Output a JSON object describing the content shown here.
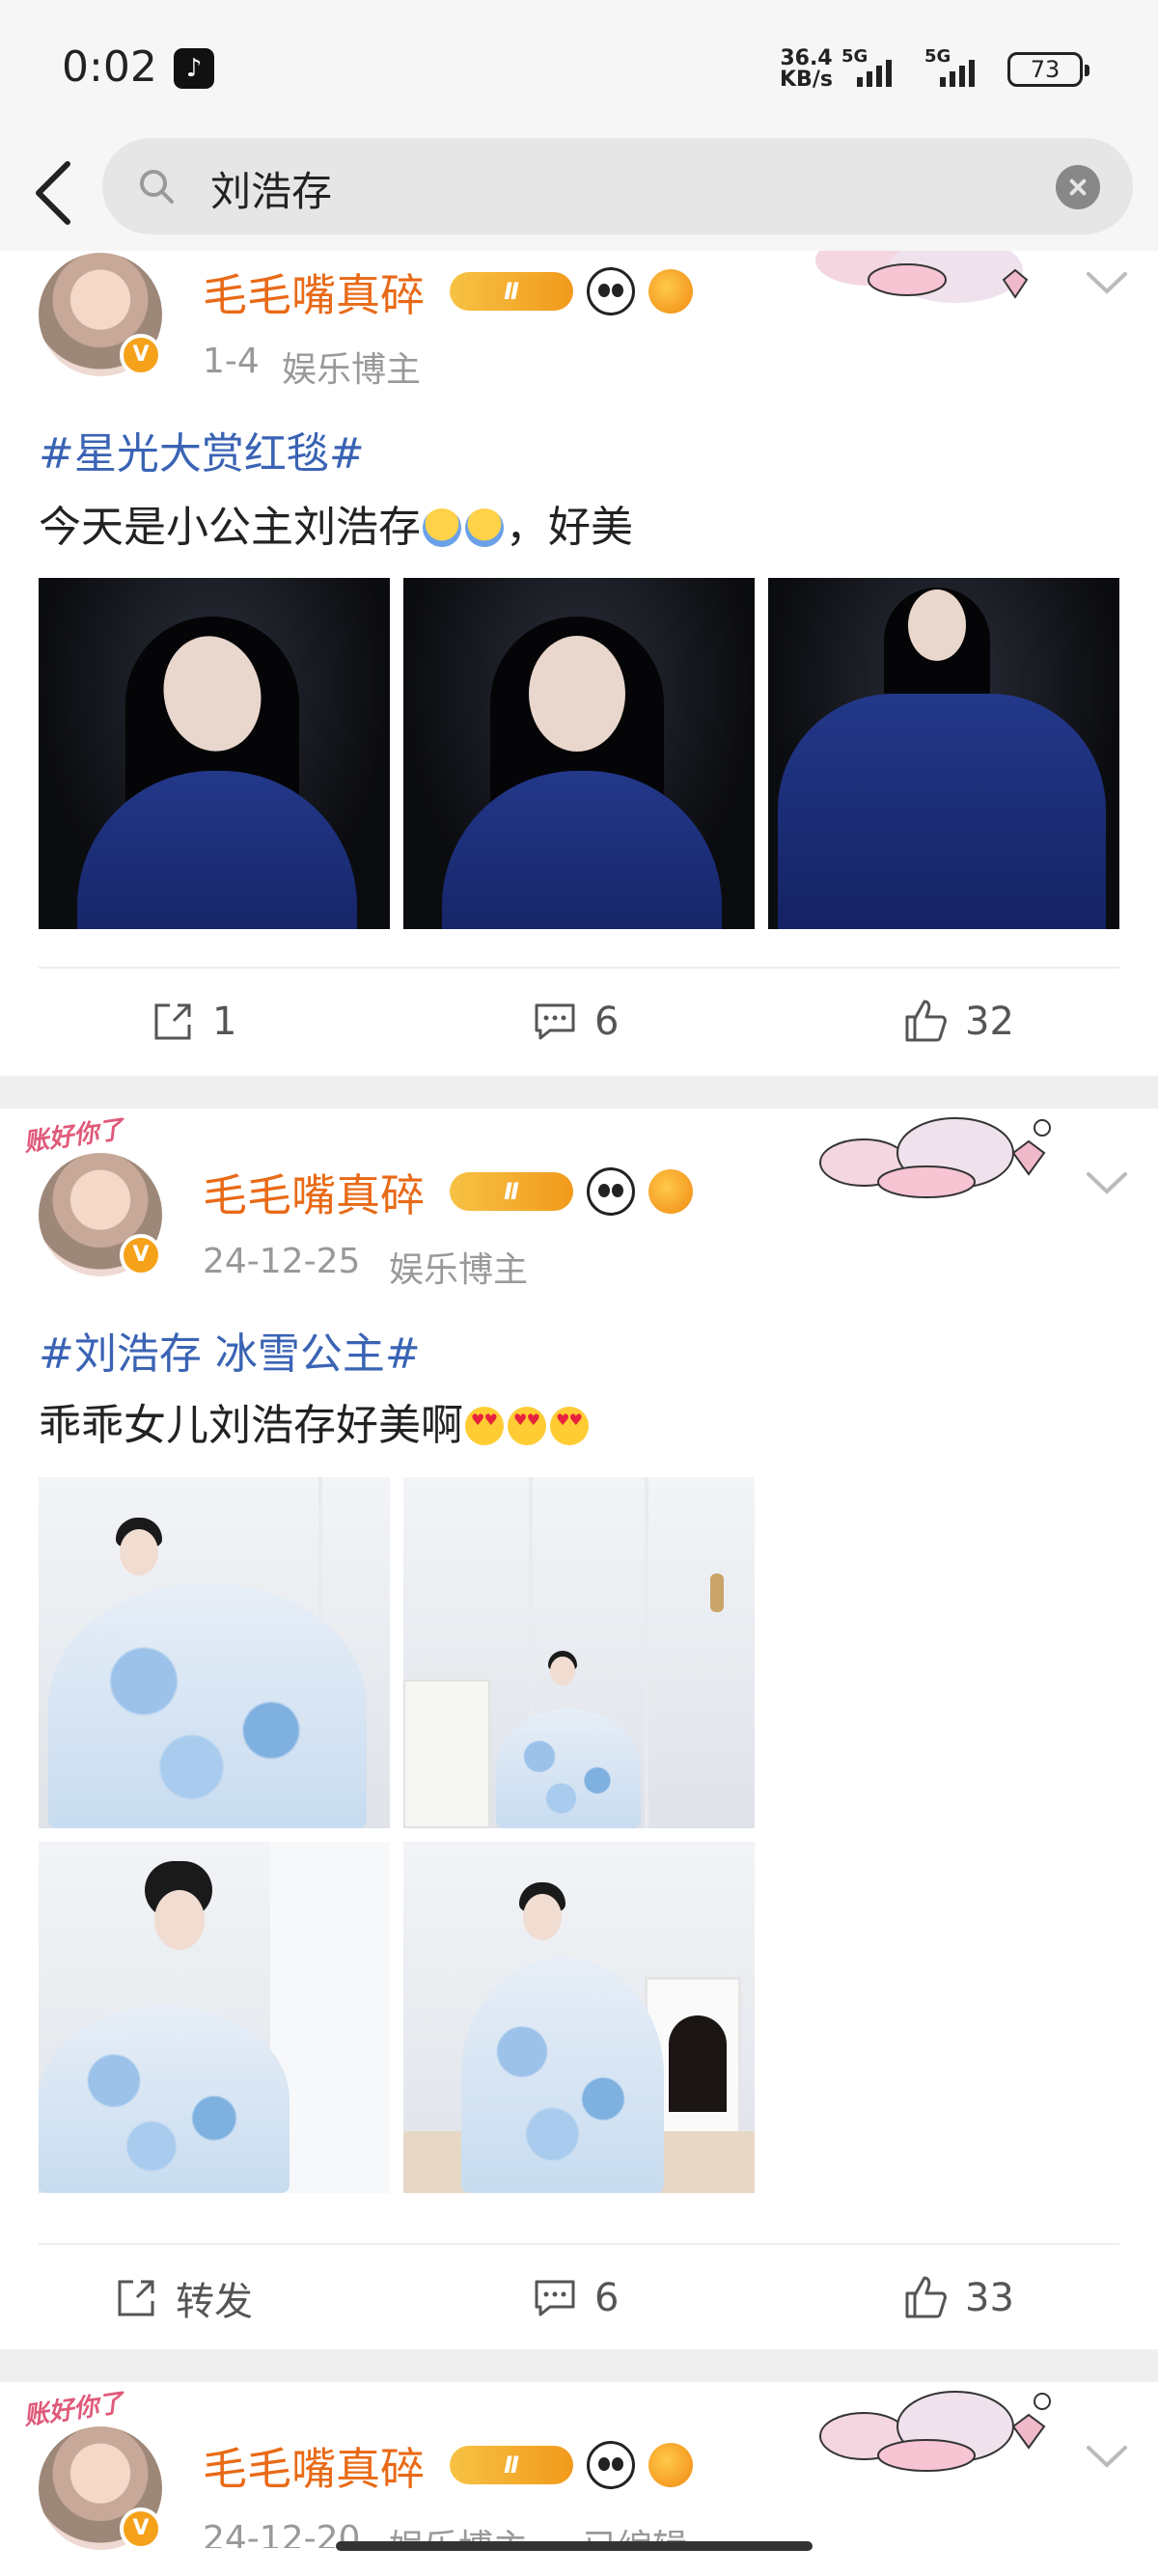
{
  "status_bar": {
    "time": "0:02",
    "net_speed_value": "36.4",
    "net_speed_unit": "KB/s",
    "signal_1_label": "5G",
    "signal_2_label": "5G",
    "battery": "73"
  },
  "search": {
    "query": "刘浩存"
  },
  "posts": [
    {
      "user_name": "毛毛嘴真碎",
      "avatar_frame_text": "",
      "level_badge": "Ⅱ",
      "verified_mark": "V",
      "time": "1-4",
      "source": "娱乐博主",
      "topic": "#星光大赏红毯#",
      "text_before_emoji": "今天是小公主刘浩存",
      "text_after_emoji": "，好美",
      "photos": [
        "dark-1",
        "dark-2",
        "dark-3"
      ],
      "repost_label": "1",
      "comment_count": "6",
      "like_count": "32"
    },
    {
      "user_name": "毛毛嘴真碎",
      "avatar_frame_text": "账好你了",
      "level_badge": "Ⅱ",
      "verified_mark": "V",
      "time": "24-12-25",
      "source": "娱乐博主",
      "topic": "#刘浩存 冰雪公主#",
      "text_before_emoji": "乖乖女儿刘浩存好美啊",
      "text_after_emoji": "",
      "photos": [
        "light-1",
        "light-2",
        "light-3",
        "light-4"
      ],
      "repost_label": "转发",
      "comment_count": "6",
      "like_count": "33"
    },
    {
      "user_name": "毛毛嘴真碎",
      "avatar_frame_text": "账好你了",
      "level_badge": "Ⅱ",
      "verified_mark": "V",
      "time": "24-12-20",
      "source": "娱乐博主",
      "edited_label": "已编辑"
    }
  ],
  "colors": {
    "username": "#e86a17",
    "topic": "#3a63b4",
    "meta": "#999999",
    "separator": "#efefef"
  },
  "icons": [
    "tiktok-icon",
    "back-icon",
    "search-icon",
    "clear-icon",
    "chevron-down-icon",
    "share-icon",
    "comment-icon",
    "like-icon",
    "panda-icon",
    "fish-icon"
  ]
}
